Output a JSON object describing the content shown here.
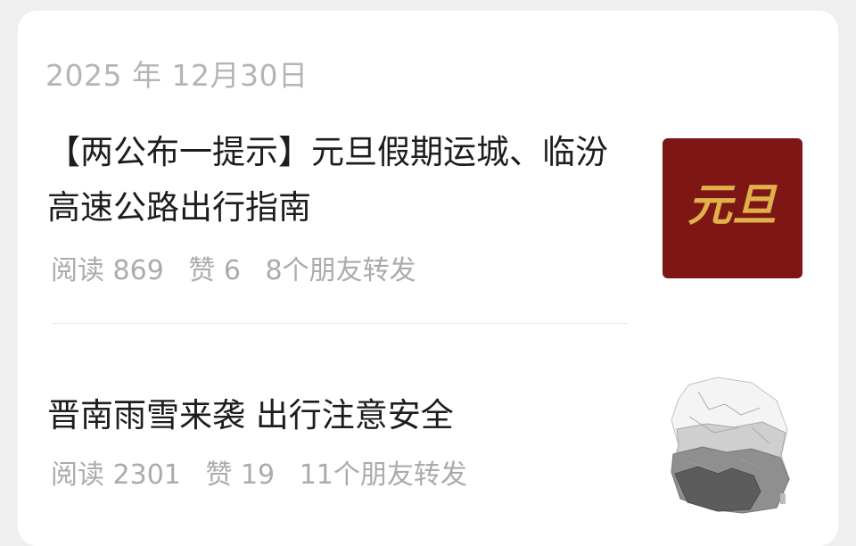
{
  "date": "2025 年 12月30日",
  "articles": [
    {
      "title": "【两公布一提示】元旦假期运城、临汾高速公路出行指南",
      "reads": "阅读 869",
      "likes": "赞 6",
      "shares": "8个朋友转发",
      "thumbnail": {
        "text": "元旦",
        "bg_color": "#7d1614",
        "text_color": "#e0b04a"
      }
    },
    {
      "title": "晋南雨雪来袭 出行注意安全",
      "reads": "阅读 2301",
      "likes": "赞 19",
      "shares": "11个朋友转发",
      "thumbnail": {
        "type": "grayscale-map"
      }
    }
  ]
}
